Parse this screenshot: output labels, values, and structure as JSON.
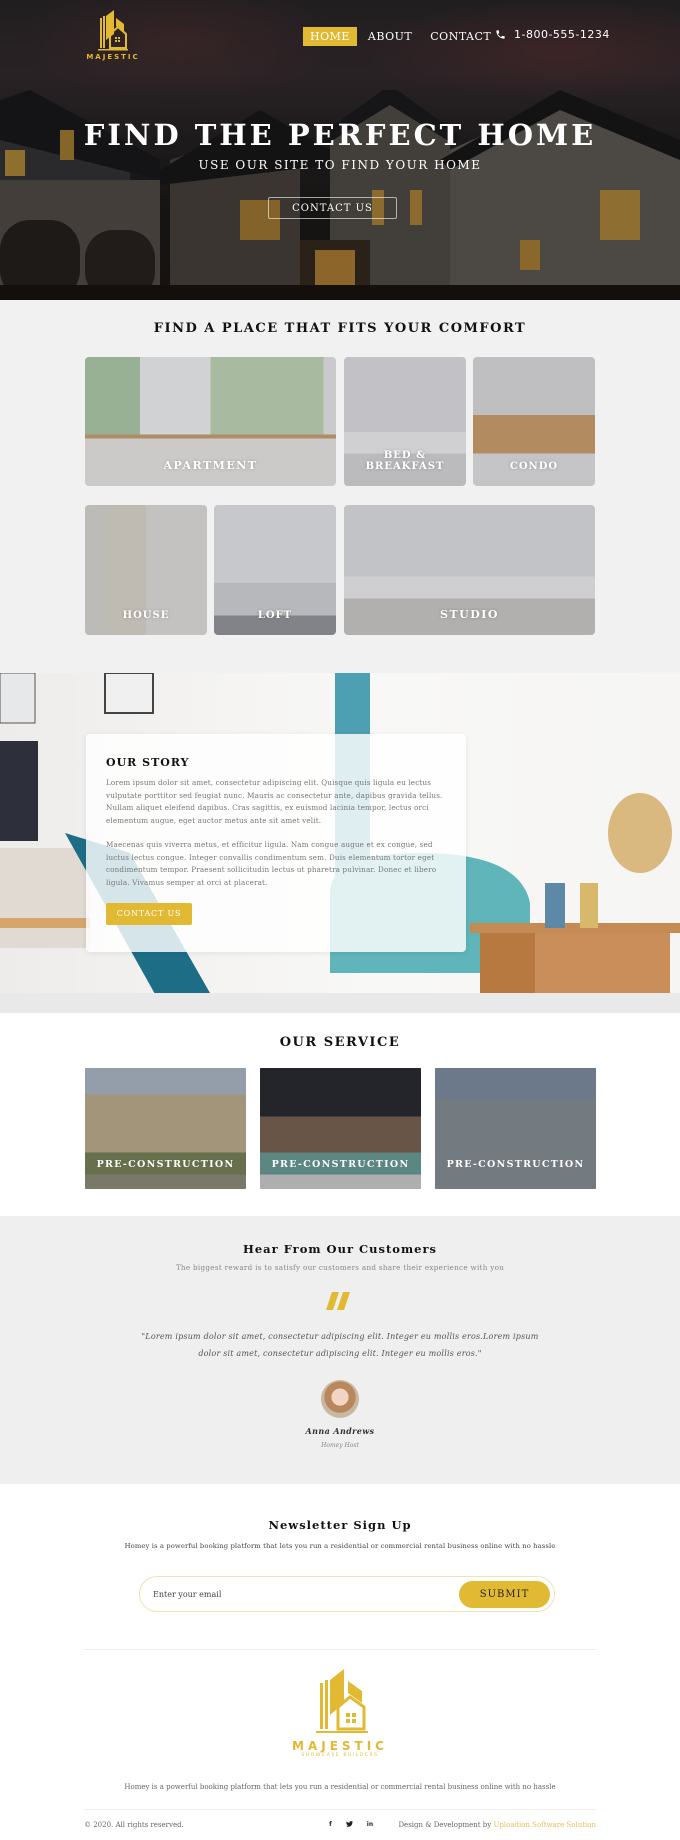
{
  "brand": {
    "name": "MAJESTIC",
    "tagline": "SHOWCASE BUILDERS",
    "accent_color": "#e2b933"
  },
  "nav": {
    "items": [
      {
        "label": "HOME",
        "active": true
      },
      {
        "label": "ABOUT",
        "active": false
      },
      {
        "label": "CONTACT",
        "active": false
      }
    ],
    "phone_icon": "phone-icon",
    "phone": "1-800-555-1234"
  },
  "hero": {
    "title": "FIND THE PERFECT HOME",
    "subtitle": "USE OUR SITE TO FIND YOUR HOME",
    "cta": "CONTACT US"
  },
  "places": {
    "title": "FIND A PLACE THAT FITS YOUR COMFORT",
    "tiles": [
      {
        "label": "APARTMENT"
      },
      {
        "label": "BED & BREAKFAST"
      },
      {
        "label": "CONDO"
      },
      {
        "label": "HOUSE"
      },
      {
        "label": "LOFT"
      },
      {
        "label": "STUDIO"
      }
    ]
  },
  "story": {
    "title": "OUR STORY",
    "paragraphs": [
      "Lorem ipsum dolor sit amet, consectetur adipiscing elit. Quisque quis ligula eu lectus vulputate porttitor sed feugiat nunc. Mauris ac consectetur ante, dapibus gravida tellus. Nullam aliquet eleifend dapibus. Cras sagittis, ex euismod lacinia tempor, lectus orci elementum augue, eget auctor metus ante sit amet velit.",
      "Maecenas quis viverra metus, et efficitur ligula. Nam congue augue et ex congue, sed luctus lectus congue. Integer convallis condimentum sem. Duis elementum tortor eget condimentum tempor. Praesent sollicitudin lectus ut pharetra pulvinar. Donec et libero ligula. Vivamus semper at orci at placerat."
    ],
    "cta": "CONTACT US"
  },
  "service": {
    "title": "OUR SERVICE",
    "items": [
      {
        "label": "PRE-CONSTRUCTION"
      },
      {
        "label": "PRE-CONSTRUCTION"
      },
      {
        "label": "PRE-CONSTRUCTION"
      }
    ]
  },
  "testimonial": {
    "title": "Hear From Our Customers",
    "subtitle": "The biggest reward is to satisfy our customers and share their experience with you",
    "quote_icon": "quote-icon",
    "quote": "\"Lorem ipsum dolor sit amet, consectetur adipiscing elit. Integer eu mollis eros.Lorem ipsum dolor sit amet, consectetur adipiscing elit. Integer eu mollis eros.\"",
    "author": "Anna Andrews",
    "role": "Homey Host"
  },
  "newsletter": {
    "title": "Newsletter Sign Up",
    "description": "Homey is a powerful booking platform that lets you run a residential or commercial rental business online with no hassle",
    "email_placeholder": "Enter your email",
    "submit": "SUBMIT"
  },
  "footer": {
    "description": "Homey is a powerful booking platform that lets you run a residential or commercial rental business online with no hassle",
    "copyright": "© 2020. All rights reserved.",
    "social": [
      {
        "icon": "facebook-icon",
        "glyph": "f"
      },
      {
        "icon": "twitter-icon",
        "glyph": "t"
      },
      {
        "icon": "linkedin-icon",
        "glyph": "in"
      }
    ],
    "credit_prefix": "Design & Development by",
    "credit_link": "Uploadion Software Solution"
  }
}
